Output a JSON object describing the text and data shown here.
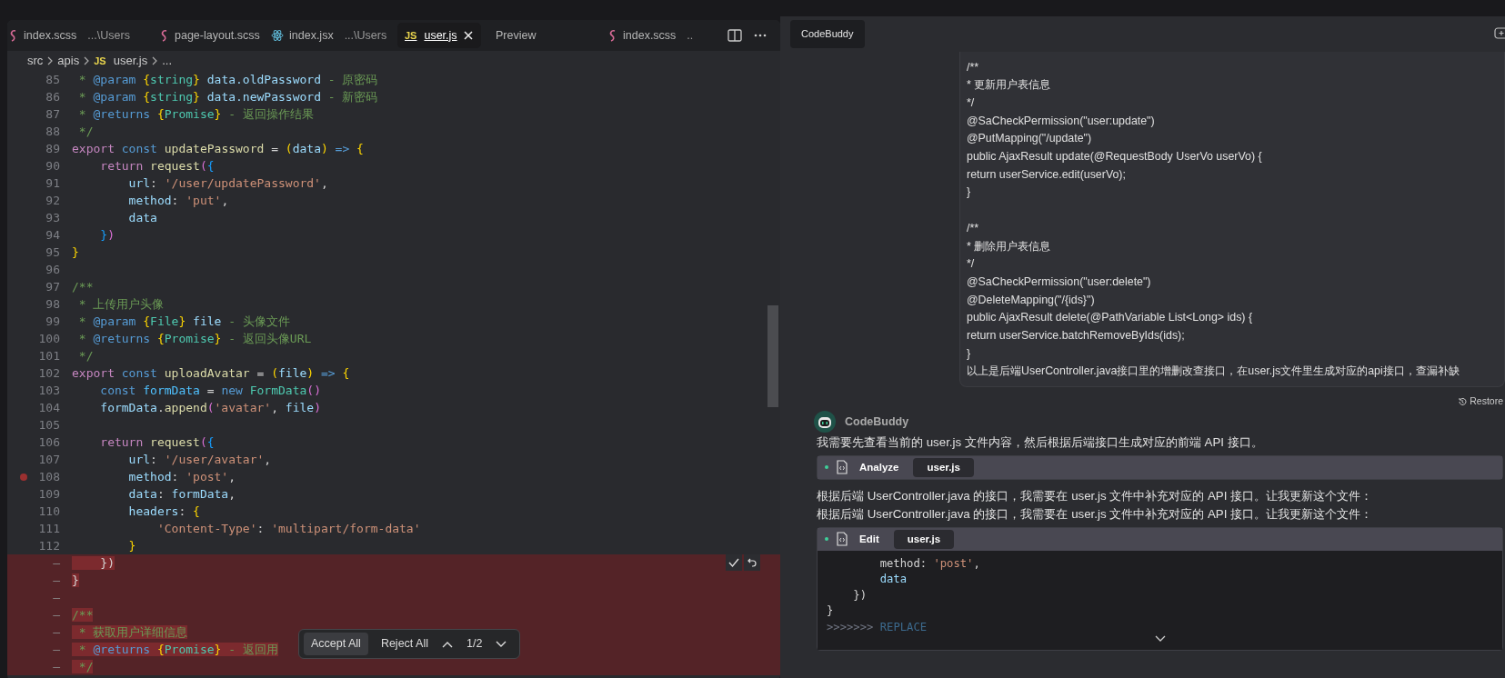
{
  "editor": {
    "tabs": [
      {
        "label": "index.scss",
        "detail": "...\\Users",
        "kind": "sass",
        "selected": false
      },
      {
        "label": "page-layout.scss",
        "kind": "sass",
        "selected": false
      },
      {
        "label": "index.jsx",
        "detail": "...\\Users",
        "kind": "react",
        "selected": false
      },
      {
        "label": "user.js",
        "badge": "JS",
        "kind": "script",
        "selected": true
      },
      {
        "label": "Preview",
        "kind": "preview",
        "selected": false
      },
      {
        "label": "index.scss",
        "detail": "..",
        "kind": "sass",
        "selected": false
      }
    ],
    "breadcrumb": [
      {
        "label": "src"
      },
      {
        "label": "apis"
      },
      {
        "label": "user.js",
        "badge": "JS"
      },
      {
        "label": "..."
      }
    ],
    "lines": [
      {
        "number": "85",
        "removed": false,
        "breakpoint": false,
        "tokens": [
          {
            "text": " * ",
            "kind": "comment"
          },
          {
            "text": "@param",
            "kind": "tag"
          },
          {
            "text": " {",
            "kind": "brace"
          },
          {
            "text": "string",
            "kind": "type"
          },
          {
            "text": "}",
            "kind": "brace"
          },
          {
            "text": " data.oldPassword",
            "kind": "variable"
          },
          {
            "text": " - 原密码",
            "kind": "comment"
          }
        ]
      },
      {
        "number": "86",
        "removed": false,
        "breakpoint": false,
        "tokens": [
          {
            "text": " * ",
            "kind": "comment"
          },
          {
            "text": "@param",
            "kind": "tag"
          },
          {
            "text": " {",
            "kind": "brace"
          },
          {
            "text": "string",
            "kind": "type"
          },
          {
            "text": "}",
            "kind": "brace"
          },
          {
            "text": " data.newPassword",
            "kind": "variable"
          },
          {
            "text": " - 新密码",
            "kind": "comment"
          }
        ]
      },
      {
        "number": "87",
        "removed": false,
        "breakpoint": false,
        "tokens": [
          {
            "text": " * ",
            "kind": "comment"
          },
          {
            "text": "@returns",
            "kind": "tag"
          },
          {
            "text": " {",
            "kind": "brace"
          },
          {
            "text": "Promise",
            "kind": "type"
          },
          {
            "text": "}",
            "kind": "brace"
          },
          {
            "text": " - 返回操作结果",
            "kind": "comment"
          }
        ]
      },
      {
        "number": "88",
        "removed": false,
        "breakpoint": false,
        "tokens": [
          {
            "text": " */",
            "kind": "comment"
          }
        ]
      },
      {
        "number": "89",
        "removed": false,
        "breakpoint": false,
        "tokens": [
          {
            "text": "export",
            "kind": "keyword"
          },
          {
            "text": " const",
            "kind": "declaration"
          },
          {
            "text": " updatePassword",
            "kind": "function"
          },
          {
            "text": " = ",
            "kind": "plain"
          },
          {
            "text": "(",
            "kind": "brace"
          },
          {
            "text": "data",
            "kind": "variable"
          },
          {
            "text": ")",
            "kind": "brace"
          },
          {
            "text": " => ",
            "kind": "declaration"
          },
          {
            "text": "{",
            "kind": "brace"
          }
        ]
      },
      {
        "number": "90",
        "removed": false,
        "breakpoint": false,
        "tokens": [
          {
            "text": "    return",
            "kind": "keyword"
          },
          {
            "text": " request",
            "kind": "function"
          },
          {
            "text": "(",
            "kind": "paren"
          },
          {
            "text": "{",
            "kind": "bracket"
          }
        ]
      },
      {
        "number": "91",
        "removed": false,
        "breakpoint": false,
        "tokens": [
          {
            "text": "        url",
            "kind": "variable"
          },
          {
            "text": ": ",
            "kind": "plain"
          },
          {
            "text": "'/user/updatePassword'",
            "kind": "string"
          },
          {
            "text": ",",
            "kind": "plain"
          }
        ]
      },
      {
        "number": "92",
        "removed": false,
        "breakpoint": false,
        "tokens": [
          {
            "text": "        method",
            "kind": "variable"
          },
          {
            "text": ": ",
            "kind": "plain"
          },
          {
            "text": "'put'",
            "kind": "string"
          },
          {
            "text": ",",
            "kind": "plain"
          }
        ]
      },
      {
        "number": "93",
        "removed": false,
        "breakpoint": false,
        "tokens": [
          {
            "text": "        data",
            "kind": "variable"
          }
        ]
      },
      {
        "number": "94",
        "removed": false,
        "breakpoint": false,
        "tokens": [
          {
            "text": "    }",
            "kind": "bracket"
          },
          {
            "text": ")",
            "kind": "paren"
          }
        ]
      },
      {
        "number": "95",
        "removed": false,
        "breakpoint": false,
        "tokens": [
          {
            "text": "}",
            "kind": "brace"
          }
        ]
      },
      {
        "number": "96",
        "removed": false,
        "breakpoint": false
      },
      {
        "number": "97",
        "removed": false,
        "breakpoint": false,
        "tokens": [
          {
            "text": "/**",
            "kind": "comment"
          }
        ]
      },
      {
        "number": "98",
        "removed": false,
        "breakpoint": false,
        "tokens": [
          {
            "text": " * 上传用户头像",
            "kind": "comment"
          }
        ]
      },
      {
        "number": "99",
        "removed": false,
        "breakpoint": false,
        "tokens": [
          {
            "text": " * ",
            "kind": "comment"
          },
          {
            "text": "@param",
            "kind": "tag"
          },
          {
            "text": " {",
            "kind": "brace"
          },
          {
            "text": "File",
            "kind": "type"
          },
          {
            "text": "}",
            "kind": "brace"
          },
          {
            "text": " file",
            "kind": "variable"
          },
          {
            "text": " - 头像文件",
            "kind": "comment"
          }
        ]
      },
      {
        "number": "100",
        "removed": false,
        "breakpoint": false,
        "tokens": [
          {
            "text": " * ",
            "kind": "comment"
          },
          {
            "text": "@returns",
            "kind": "tag"
          },
          {
            "text": " {",
            "kind": "brace"
          },
          {
            "text": "Promise",
            "kind": "type"
          },
          {
            "text": "}",
            "kind": "brace"
          },
          {
            "text": " - 返回头像URL",
            "kind": "comment"
          }
        ]
      },
      {
        "number": "101",
        "removed": false,
        "breakpoint": false,
        "tokens": [
          {
            "text": " */",
            "kind": "comment"
          }
        ]
      },
      {
        "number": "102",
        "removed": false,
        "breakpoint": false,
        "tokens": [
          {
            "text": "export",
            "kind": "keyword"
          },
          {
            "text": " const",
            "kind": "declaration"
          },
          {
            "text": " uploadAvatar",
            "kind": "function"
          },
          {
            "text": " = ",
            "kind": "plain"
          },
          {
            "text": "(",
            "kind": "brace"
          },
          {
            "text": "file",
            "kind": "variable"
          },
          {
            "text": ")",
            "kind": "brace"
          },
          {
            "text": " => ",
            "kind": "declaration"
          },
          {
            "text": "{",
            "kind": "brace"
          }
        ]
      },
      {
        "number": "103",
        "removed": false,
        "breakpoint": false,
        "tokens": [
          {
            "text": "    const",
            "kind": "declaration"
          },
          {
            "text": " formData",
            "kind": "constant"
          },
          {
            "text": " = ",
            "kind": "plain"
          },
          {
            "text": "new",
            "kind": "declaration"
          },
          {
            "text": " FormData",
            "kind": "type"
          },
          {
            "text": "()",
            "kind": "paren"
          }
        ]
      },
      {
        "number": "104",
        "removed": false,
        "breakpoint": false,
        "tokens": [
          {
            "text": "    formData",
            "kind": "variable"
          },
          {
            "text": ".",
            "kind": "plain"
          },
          {
            "text": "append",
            "kind": "function"
          },
          {
            "text": "(",
            "kind": "paren"
          },
          {
            "text": "'avatar'",
            "kind": "string"
          },
          {
            "text": ", ",
            "kind": "plain"
          },
          {
            "text": "file",
            "kind": "variable"
          },
          {
            "text": ")",
            "kind": "paren"
          }
        ]
      },
      {
        "number": "105",
        "removed": false,
        "breakpoint": false
      },
      {
        "number": "106",
        "removed": false,
        "breakpoint": false,
        "tokens": [
          {
            "text": "    return",
            "kind": "keyword"
          },
          {
            "text": " request",
            "kind": "function"
          },
          {
            "text": "(",
            "kind": "paren"
          },
          {
            "text": "{",
            "kind": "bracket"
          }
        ]
      },
      {
        "number": "107",
        "removed": false,
        "breakpoint": false,
        "tokens": [
          {
            "text": "        url",
            "kind": "variable"
          },
          {
            "text": ": ",
            "kind": "plain"
          },
          {
            "text": "'/user/avatar'",
            "kind": "string"
          },
          {
            "text": ",",
            "kind": "plain"
          }
        ]
      },
      {
        "number": "108",
        "removed": false,
        "breakpoint": true,
        "tokens": [
          {
            "text": "        method",
            "kind": "variable"
          },
          {
            "text": ": ",
            "kind": "plain"
          },
          {
            "text": "'post'",
            "kind": "string"
          },
          {
            "text": ",",
            "kind": "plain"
          }
        ]
      },
      {
        "number": "109",
        "removed": false,
        "breakpoint": false,
        "tokens": [
          {
            "text": "        data",
            "kind": "variable"
          },
          {
            "text": ": ",
            "kind": "plain"
          },
          {
            "text": "formData",
            "kind": "variable"
          },
          {
            "text": ",",
            "kind": "plain"
          }
        ]
      },
      {
        "number": "110",
        "removed": false,
        "breakpoint": false,
        "tokens": [
          {
            "text": "        headers",
            "kind": "variable"
          },
          {
            "text": ": ",
            "kind": "plain"
          },
          {
            "text": "{",
            "kind": "brace"
          }
        ]
      },
      {
        "number": "111",
        "removed": false,
        "breakpoint": false,
        "tokens": [
          {
            "text": "            'Content-Type'",
            "kind": "string"
          },
          {
            "text": ": ",
            "kind": "plain"
          },
          {
            "text": "'multipart/form-data'",
            "kind": "string"
          }
        ]
      },
      {
        "number": "112",
        "removed": false,
        "breakpoint": false,
        "tokens": [
          {
            "text": "        }",
            "kind": "brace"
          }
        ]
      },
      {
        "number": "—",
        "removed": true,
        "breakpoint": false,
        "tokens": [
          {
            "text": "    })",
            "kind": "plain"
          }
        ]
      },
      {
        "number": "—",
        "removed": true,
        "breakpoint": false,
        "tokens": [
          {
            "text": "}",
            "kind": "plain"
          }
        ]
      },
      {
        "number": "—",
        "removed": true,
        "breakpoint": false
      },
      {
        "number": "—",
        "removed": true,
        "breakpoint": false,
        "tokens": [
          {
            "text": "/**",
            "kind": "comment"
          }
        ]
      },
      {
        "number": "—",
        "removed": true,
        "breakpoint": false,
        "tokens": [
          {
            "text": " * 获取用户详细信息",
            "kind": "comment"
          }
        ]
      },
      {
        "number": "—",
        "removed": true,
        "breakpoint": false,
        "tokens": [
          {
            "text": " * ",
            "kind": "comment"
          },
          {
            "text": "@returns",
            "kind": "tag"
          },
          {
            "text": " {",
            "kind": "brace"
          },
          {
            "text": "Promise",
            "kind": "type"
          },
          {
            "text": "}",
            "kind": "brace"
          },
          {
            "text": " - 返回用",
            "kind": "comment"
          }
        ]
      },
      {
        "number": "—",
        "removed": true,
        "breakpoint": false,
        "tokens": [
          {
            "text": " */",
            "kind": "comment"
          }
        ]
      }
    ],
    "review_bar": {
      "accept": "Accept All",
      "reject": "Reject All",
      "counter": "1/2"
    }
  },
  "chat": {
    "tab": "CodeBuddy",
    "user_message": {
      "blocks": [
        [
          "/**",
          "* 更新用户表信息",
          "*/",
          "@SaCheckPermission(\"user:update\")",
          "@PutMapping(\"/update\")",
          "public AjaxResult update(@RequestBody UserVo userVo) {",
          "return userService.edit(userVo);",
          "}"
        ],
        [
          "/**",
          "* 删除用户表信息",
          "*/",
          "@SaCheckPermission(\"user:delete\")",
          "@DeleteMapping(\"/{ids}\")",
          "public AjaxResult delete(@PathVariable List<Long> ids) {",
          "return userService.batchRemoveByIds(ids);",
          "}",
          "以上是后端UserController.java接口里的增删改查接口，在user.js文件里生成对应的api接口，查漏补缺"
        ]
      ],
      "restore": "Restore"
    },
    "assistant": {
      "name": "CodeBuddy",
      "items": [
        {
          "kind": "text",
          "text": "我需要先查看当前的 user.js 文件内容，然后根据后端接口生成对应的前端 API 接口。"
        },
        {
          "kind": "tool",
          "action": "Analyze",
          "file": "user.js",
          "color": "#3ecf9a"
        },
        {
          "kind": "text",
          "text": "根据后端 UserController.java 的接口，我需要在 user.js 文件中补充对应的 API 接口。让我更新这个文件："
        },
        {
          "kind": "text",
          "text": "根据后端 UserController.java 的接口，我需要在 user.js 文件中补充对应的 API 接口。让我更新这个文件："
        },
        {
          "kind": "tool",
          "action": "Edit",
          "file": "user.js",
          "color": "#3ecf9a",
          "code": [
            [
              {
                "text": "        method",
                "kind": "plain"
              },
              {
                "text": ": ",
                "kind": "plain"
              },
              {
                "text": "'post'",
                "kind": "string"
              },
              {
                "text": ",",
                "kind": "plain"
              }
            ],
            [
              {
                "text": "        data",
                "kind": "variable"
              }
            ],
            [
              {
                "text": "    })",
                "kind": "plain"
              }
            ],
            [
              {
                "text": "}",
                "kind": "plain"
              }
            ],
            [
              {
                "text": ">>>>>>> ",
                "kind": "dim"
              },
              {
                "text": "REPLACE",
                "kind": "marker"
              }
            ]
          ]
        }
      ]
    }
  }
}
